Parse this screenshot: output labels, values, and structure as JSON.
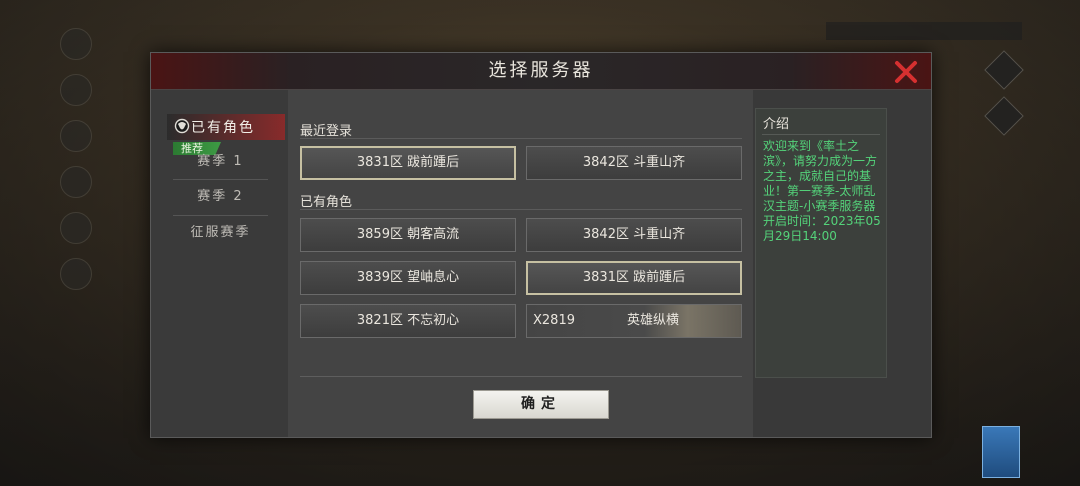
{
  "modal": {
    "title": "选择服务器",
    "close_icon": "close-x-icon"
  },
  "sidebar": {
    "existing_tab_label": "已有角色",
    "existing_tab_icon": "character-head-icon",
    "recommend_badge": "推荐",
    "seasons": [
      "赛季 1",
      "赛季 2",
      "征服赛季"
    ]
  },
  "main": {
    "recent": {
      "label": "最近登录",
      "servers": [
        {
          "text": "3831区 跋前踵后",
          "selected": true
        },
        {
          "text": "3842区 斗重山齐",
          "selected": false
        }
      ]
    },
    "existing": {
      "label": "已有角色",
      "servers": [
        {
          "text": "3859区 朝客高流",
          "selected": false
        },
        {
          "text": "3842区 斗重山齐",
          "selected": false
        },
        {
          "text": "3839区 望岫息心",
          "selected": false
        },
        {
          "text": "3831区 跋前踵后",
          "selected": true
        },
        {
          "text": "3821区 不忘初心",
          "selected": false
        }
      ],
      "special_server": {
        "name": "X2819",
        "title": "英雄纵横"
      }
    },
    "confirm_label": "确定"
  },
  "intro": {
    "title": "介绍",
    "text": "欢迎来到《率土之滨》，请努力成为一方之主，成就自己的基业！第一赛季-太师乱汉主题-小赛季服务器开启时间：2023年05月29日14:00"
  },
  "colors": {
    "intro_text": "#54d37a",
    "accent_red": "#c62a2a",
    "badge_green": "#2c7a32"
  }
}
